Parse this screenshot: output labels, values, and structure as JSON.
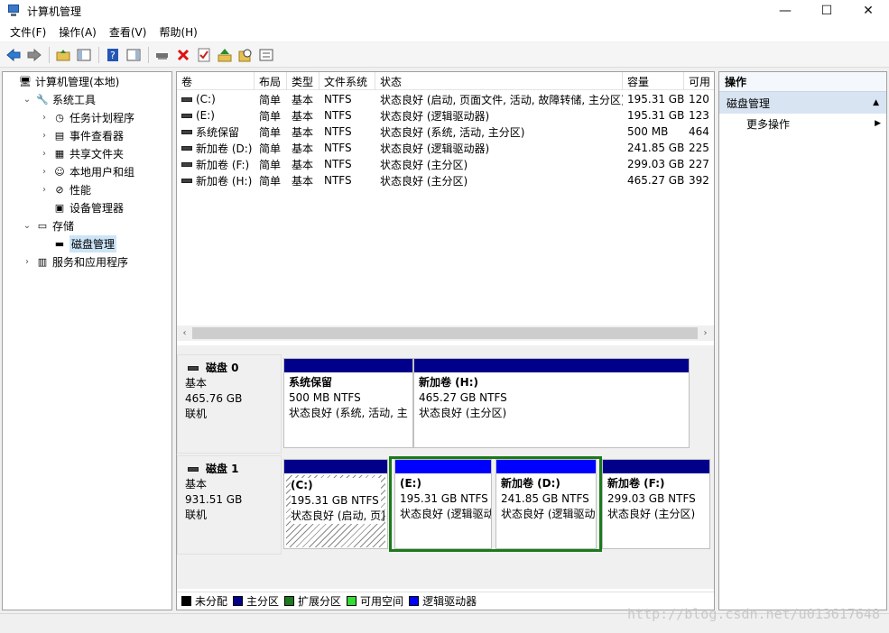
{
  "window": {
    "title": "计算机管理",
    "minimize": "—",
    "maximize": "☐",
    "close": "✕"
  },
  "menu": [
    "文件(F)",
    "操作(A)",
    "查看(V)",
    "帮助(H)"
  ],
  "toolbar_icons": [
    "back-arrow-icon",
    "forward-arrow-icon",
    "up-folder-icon",
    "show-hide-tree-icon",
    "help-icon",
    "properties-icon",
    "connect-icon",
    "delete-icon",
    "check-icon",
    "upload-icon",
    "search-icon",
    "list-icon"
  ],
  "tree": [
    {
      "label": "计算机管理(本地)",
      "level": 0,
      "expander": "",
      "icon": "computer-management-icon"
    },
    {
      "label": "系统工具",
      "level": 1,
      "expander": "⌄",
      "icon": "tools-icon"
    },
    {
      "label": "任务计划程序",
      "level": 2,
      "expander": "›",
      "icon": "clock-icon"
    },
    {
      "label": "事件查看器",
      "level": 2,
      "expander": "›",
      "icon": "event-viewer-icon"
    },
    {
      "label": "共享文件夹",
      "level": 2,
      "expander": "›",
      "icon": "shared-folder-icon"
    },
    {
      "label": "本地用户和组",
      "level": 2,
      "expander": "›",
      "icon": "users-icon"
    },
    {
      "label": "性能",
      "level": 2,
      "expander": "›",
      "icon": "performance-icon"
    },
    {
      "label": "设备管理器",
      "level": 2,
      "expander": "",
      "icon": "device-manager-icon"
    },
    {
      "label": "存储",
      "level": 1,
      "expander": "⌄",
      "icon": "storage-icon"
    },
    {
      "label": "磁盘管理",
      "level": 2,
      "expander": "",
      "icon": "disk-icon",
      "selected": true
    },
    {
      "label": "服务和应用程序",
      "level": 1,
      "expander": "›",
      "icon": "services-icon"
    }
  ],
  "volume_table": {
    "headers": [
      "卷",
      "布局",
      "类型",
      "文件系统",
      "状态",
      "容量",
      "可用"
    ],
    "rows": [
      [
        "(C:)",
        "简单",
        "基本",
        "NTFS",
        "状态良好 (启动, 页面文件, 活动, 故障转储, 主分区)",
        "195.31 GB",
        "120"
      ],
      [
        "(E:)",
        "简单",
        "基本",
        "NTFS",
        "状态良好 (逻辑驱动器)",
        "195.31 GB",
        "123"
      ],
      [
        "系统保留",
        "简单",
        "基本",
        "NTFS",
        "状态良好 (系统, 活动, 主分区)",
        "500 MB",
        "464"
      ],
      [
        "新加卷 (D:)",
        "简单",
        "基本",
        "NTFS",
        "状态良好 (逻辑驱动器)",
        "241.85 GB",
        "225"
      ],
      [
        "新加卷 (F:)",
        "简单",
        "基本",
        "NTFS",
        "状态良好 (主分区)",
        "299.03 GB",
        "227"
      ],
      [
        "新加卷 (H:)",
        "简单",
        "基本",
        "NTFS",
        "状态良好 (主分区)",
        "465.27 GB",
        "392"
      ]
    ]
  },
  "scroll": {
    "left": "‹",
    "right": "›"
  },
  "disks": [
    {
      "name": "磁盘 0",
      "type": "基本",
      "size": "465.76 GB",
      "status": "联机",
      "partitions": [
        {
          "name": "系统保留",
          "size": "500 MB NTFS",
          "status": "状态良好 (系统, 活动, 主",
          "bar_color": "#00008b"
        },
        {
          "name": "新加卷  (H:)",
          "size": "465.27 GB NTFS",
          "status": "状态良好 (主分区)",
          "bar_color": "#00008b"
        }
      ]
    },
    {
      "name": "磁盘 1",
      "type": "基本",
      "size": "931.51 GB",
      "status": "联机",
      "partitions": [
        {
          "name": "(C:)",
          "size": "195.31 GB NTFS",
          "status": "状态良好 (启动, 页]",
          "bar_color": "#00008b"
        },
        {
          "name": "(E:)",
          "size": "195.31 GB NTFS",
          "status": "状态良好 (逻辑驱动",
          "bar_color": "#0000ff"
        },
        {
          "name": "新加卷  (D:)",
          "size": "241.85 GB NTFS",
          "status": "状态良好 (逻辑驱动",
          "bar_color": "#0000ff"
        },
        {
          "name": "新加卷  (F:)",
          "size": "299.03 GB NTFS",
          "status": "状态良好 (主分区)",
          "bar_color": "#00008b"
        }
      ]
    }
  ],
  "legend": [
    {
      "label": "未分配",
      "color": "#000000"
    },
    {
      "label": "主分区",
      "color": "#00008b"
    },
    {
      "label": "扩展分区",
      "color": "#1b7a1b"
    },
    {
      "label": "可用空间",
      "color": "#33dd33"
    },
    {
      "label": "逻辑驱动器",
      "color": "#0000ff"
    }
  ],
  "actions": {
    "header": "操作",
    "section": "磁盘管理",
    "section_arrow": "▲",
    "item": "更多操作",
    "item_arrow": "▶"
  },
  "watermark": "http://blog.csdn.net/u013617648"
}
